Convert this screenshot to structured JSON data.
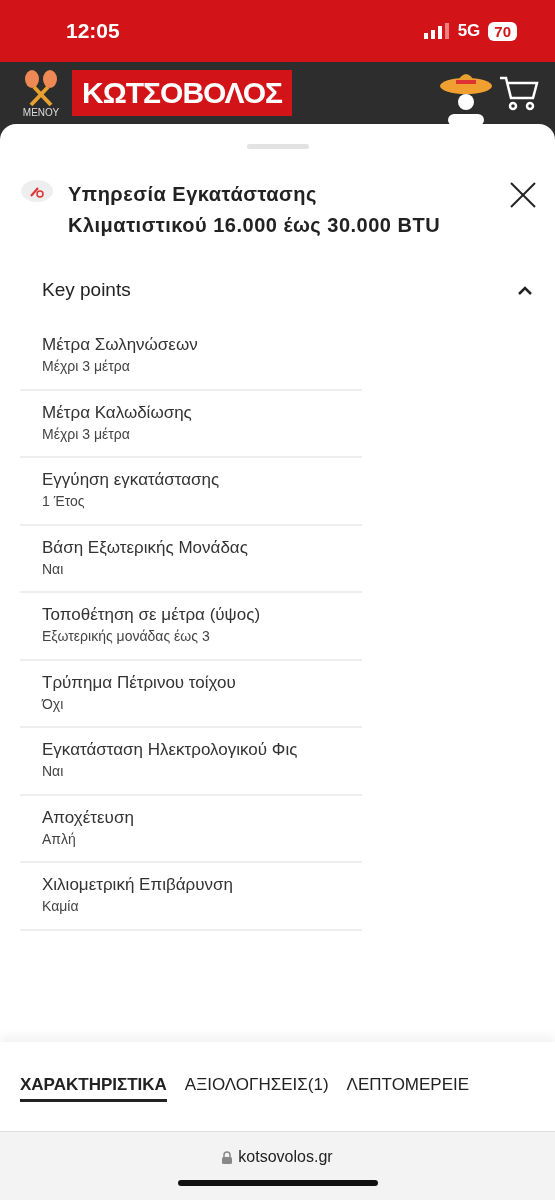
{
  "status_bar": {
    "time": "12:05",
    "network": "5G",
    "battery": "70"
  },
  "header": {
    "menu_label": "ΜΕΝΟΥ",
    "logo": "ΚΩΤΣΟΒΟΛΟΣ"
  },
  "sheet": {
    "title": "Υπηρεσία Εγκατάστασης Κλιματιστικού 16.000 έως 30.000 BTU",
    "section": {
      "title": "Key points",
      "expanded": true,
      "items": [
        {
          "label": "Μέτρα Σωληνώσεων",
          "value": "Μέχρι 3 μέτρα"
        },
        {
          "label": "Μέτρα Καλωδίωσης",
          "value": "Μέχρι 3 μέτρα"
        },
        {
          "label": "Εγγύηση εγκατάστασης",
          "value": "1 Έτος"
        },
        {
          "label": "Βάση Εξωτερικής Μονάδας",
          "value": "Ναι"
        },
        {
          "label": "Τοποθέτηση σε μέτρα (ύψος)",
          "value": "Εξωτερικής μονάδας έως 3"
        },
        {
          "label": "Τρύπημα Πέτρινου τοίχου",
          "value": "Όχι"
        },
        {
          "label": "Εγκατάσταση Ηλεκτρολογικού Φις",
          "value": "Ναι"
        },
        {
          "label": "Αποχέτευση",
          "value": "Απλή"
        },
        {
          "label": "Χιλιομετρική Επιβάρυνση",
          "value": "Καμία"
        }
      ]
    }
  },
  "tabs": [
    {
      "label": "ΧΑΡΑΚΤΗΡΙΣΤΙΚΑ",
      "selected": true
    },
    {
      "label": "ΑΞΙΟΛΟΓΗΣΕΙΣ(1)",
      "selected": false
    },
    {
      "label": "ΛΕΠΤΟΜΕΡΕΙΕ",
      "selected": false
    }
  ],
  "browser": {
    "url": "kotsovolos.gr"
  }
}
